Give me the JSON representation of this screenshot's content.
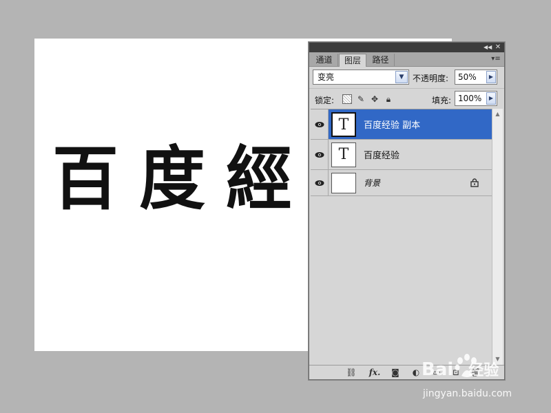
{
  "canvas": {
    "text": "百度經"
  },
  "panel": {
    "tabs": [
      {
        "label": "通道"
      },
      {
        "label": "图层"
      },
      {
        "label": "路径"
      }
    ],
    "blend_mode": "变亮",
    "opacity_label": "不透明度:",
    "opacity_value": "50%",
    "lock_label": "锁定:",
    "fill_label": "填充:",
    "fill_value": "100%",
    "layers": [
      {
        "name": "百度经验 副本",
        "thumb": "T",
        "selected": true
      },
      {
        "name": "百度经验",
        "thumb": "T",
        "selected": false
      },
      {
        "name": "背景",
        "thumb": "",
        "selected": false
      }
    ],
    "bottom_icons": [
      "link-icon",
      "fx-icon",
      "mask-icon",
      "adjustment-icon",
      "folder-icon",
      "new-layer-icon",
      "trash-icon"
    ],
    "fx_label": "fx."
  },
  "watermark": {
    "logo": "Bai",
    "logo_suffix": "经验",
    "url": "jingyan.baidu.com"
  },
  "colors": {
    "selected_row": "#3168c6",
    "workspace": "#b4b4b4"
  }
}
